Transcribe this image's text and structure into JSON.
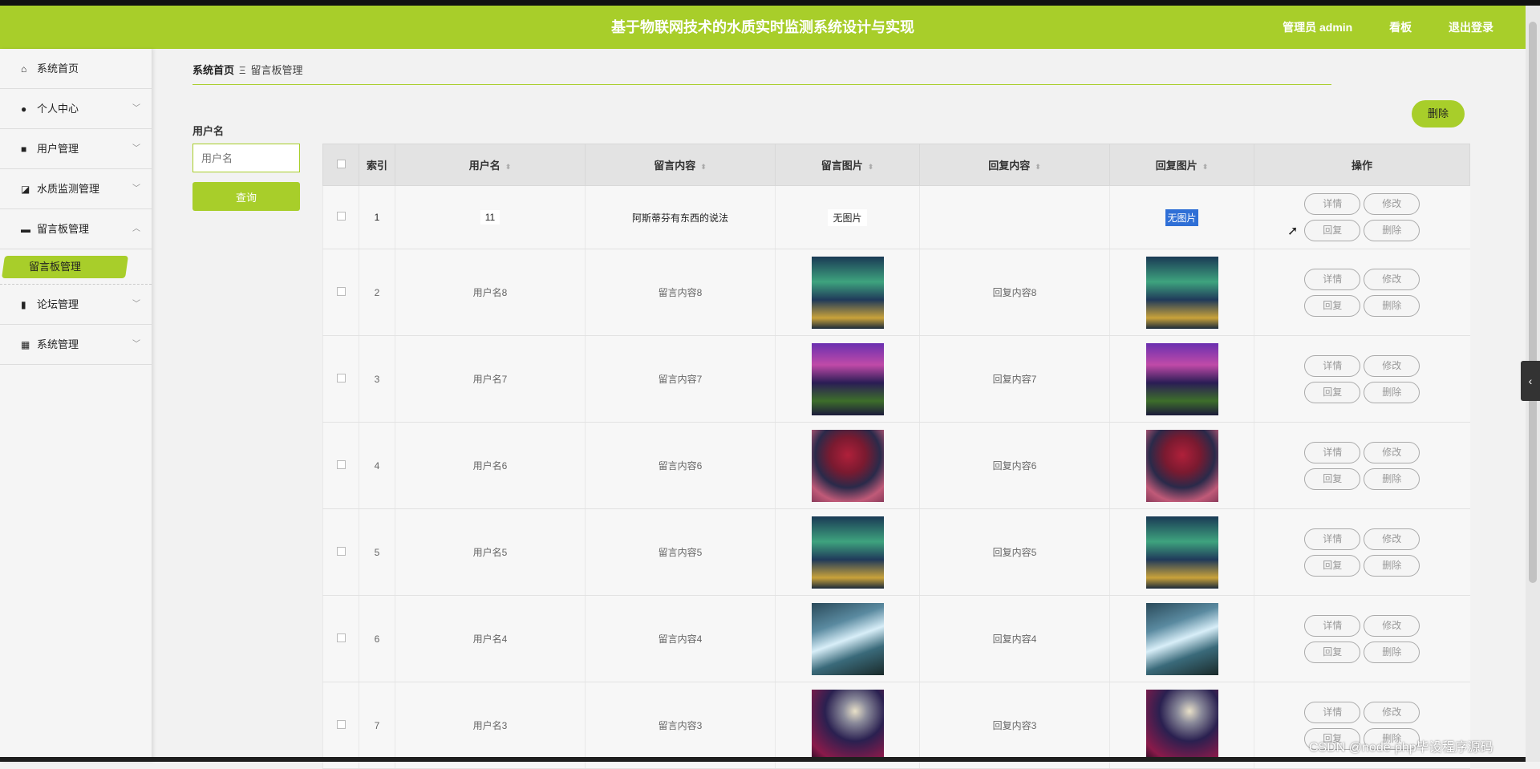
{
  "header": {
    "title": "基于物联网技术的水质实时监测系统设计与实现",
    "user": "管理员 admin",
    "board": "看板",
    "logout": "退出登录"
  },
  "sidebar": {
    "items": [
      {
        "label": "系统首页",
        "icon": "home-icon"
      },
      {
        "label": "个人中心",
        "icon": "user-icon"
      },
      {
        "label": "用户管理",
        "icon": "video-icon"
      },
      {
        "label": "水质监测管理",
        "icon": "chart-icon"
      },
      {
        "label": "留言板管理",
        "icon": "monitor-icon"
      },
      {
        "label": "论坛管理",
        "icon": "bar-chart-icon"
      },
      {
        "label": "系统管理",
        "icon": "grid-icon"
      }
    ],
    "sub_active": "留言板管理"
  },
  "breadcrumb": {
    "home": "系统首页",
    "separator": "Ξ",
    "current": "留言板管理"
  },
  "search": {
    "label": "用户名",
    "placeholder": "用户名",
    "button": "查询"
  },
  "toolbar": {
    "delete_label": "删除"
  },
  "table": {
    "headers": {
      "index": "索引",
      "username": "用户名",
      "content": "留言内容",
      "image": "留言图片",
      "reply": "回复内容",
      "reply_image": "回复图片",
      "ops": "操作"
    },
    "ops": {
      "detail": "详情",
      "edit": "修改",
      "reply": "回复",
      "delete": "删除"
    },
    "rows": [
      {
        "index": "1",
        "username": "11",
        "content": "阿斯蒂芬有东西的说法",
        "image": "无图片",
        "reply": "",
        "reply_image": "无图片"
      },
      {
        "index": "2",
        "username": "用户名8",
        "content": "留言内容8",
        "reply": "回复内容8",
        "photo": "aurora-cabin"
      },
      {
        "index": "3",
        "username": "用户名7",
        "content": "留言内容7",
        "reply": "回复内容7",
        "photo": "purple-coast"
      },
      {
        "index": "4",
        "username": "用户名6",
        "content": "留言内容6",
        "reply": "回复内容6",
        "photo": "red-tree"
      },
      {
        "index": "5",
        "username": "用户名5",
        "content": "留言内容5",
        "reply": "回复内容5",
        "photo": "aurora-cabin"
      },
      {
        "index": "6",
        "username": "用户名4",
        "content": "留言内容4",
        "reply": "回复内容4",
        "photo": "waterfall"
      },
      {
        "index": "7",
        "username": "用户名3",
        "content": "留言内容3",
        "reply": "回复内容3",
        "photo": "moon-tree"
      }
    ]
  },
  "watermark": "CSDN @node-php毕设程序源码",
  "colors": {
    "accent": "#a8ce2a",
    "selection": "#2f6fd6"
  }
}
